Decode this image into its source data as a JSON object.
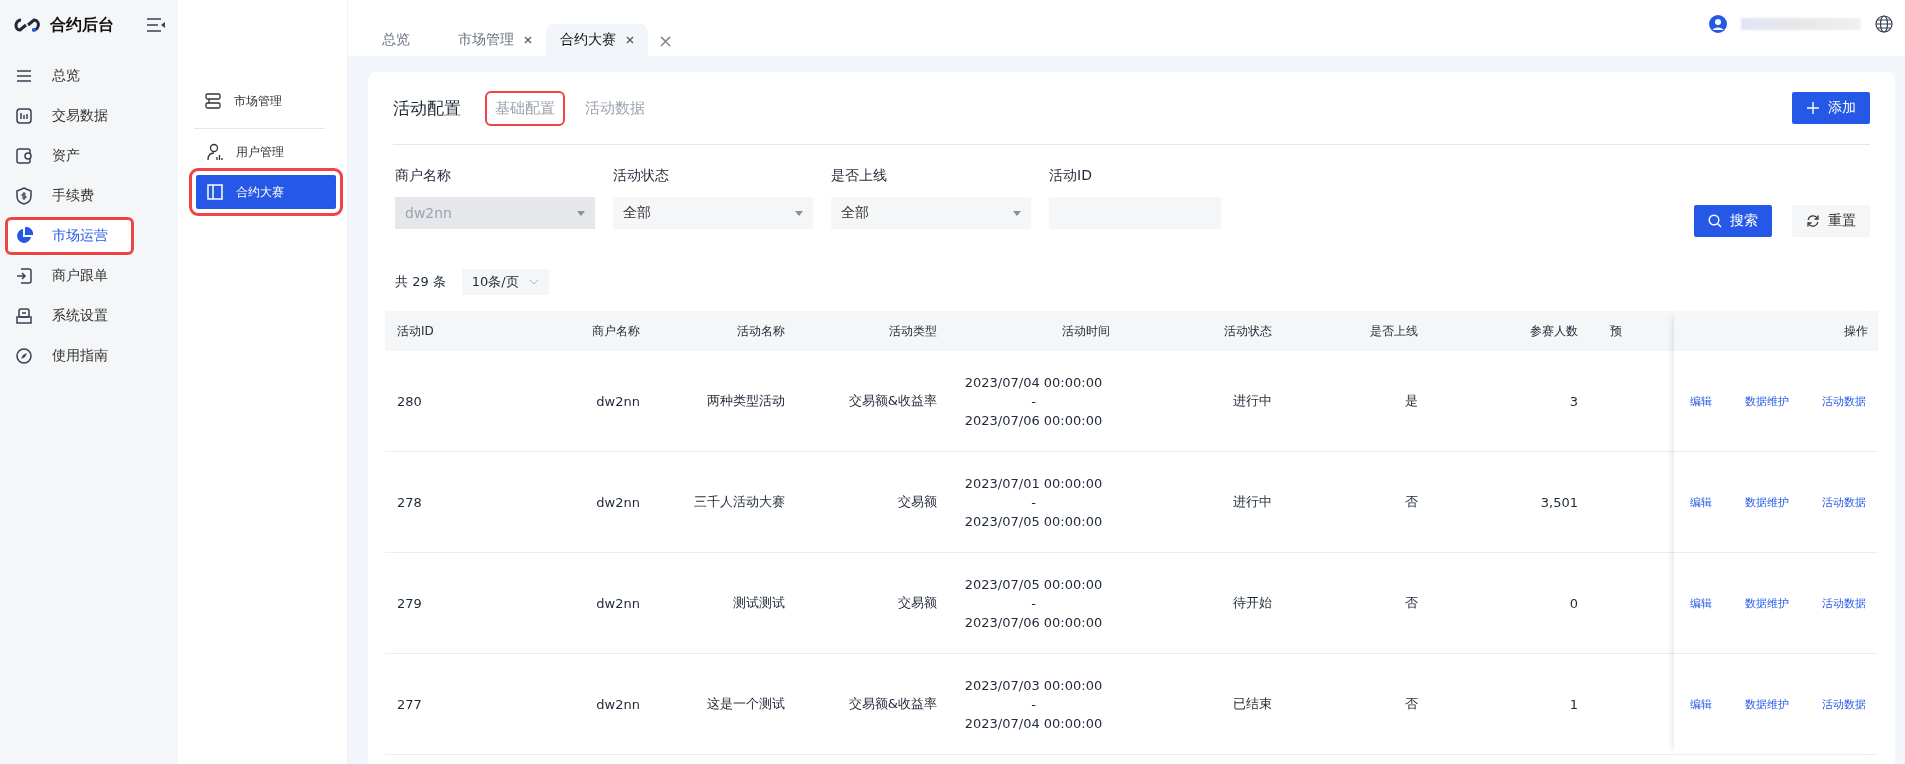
{
  "brand": {
    "title": "合约后台"
  },
  "sidebar": {
    "items": [
      {
        "label": "总览",
        "selected": false,
        "highlighted": false
      },
      {
        "label": "交易数据",
        "selected": false,
        "highlighted": false
      },
      {
        "label": "资产",
        "selected": false,
        "highlighted": false
      },
      {
        "label": "手续费",
        "selected": false,
        "highlighted": false
      },
      {
        "label": "市场运营",
        "selected": true,
        "highlighted": true
      },
      {
        "label": "商户跟单",
        "selected": false,
        "highlighted": false
      },
      {
        "label": "系统设置",
        "selected": false,
        "highlighted": false
      },
      {
        "label": "使用指南",
        "selected": false,
        "highlighted": false
      }
    ]
  },
  "submenu": {
    "items": [
      {
        "label": "市场管理",
        "selected": false,
        "highlighted": false
      },
      {
        "label": "用户管理",
        "selected": false,
        "highlighted": false
      },
      {
        "label": "合约大赛",
        "selected": true,
        "highlighted": true
      }
    ]
  },
  "tabs": [
    {
      "label": "总览",
      "closable": false,
      "selected": false
    },
    {
      "label": "市场管理",
      "closable": true,
      "selected": false
    },
    {
      "label": "合约大赛",
      "closable": true,
      "selected": true
    }
  ],
  "tabs_close_all": "×",
  "page": {
    "title": "活动配置",
    "subtabs": [
      {
        "label": "基础配置",
        "highlighted": true
      },
      {
        "label": "活动数据",
        "highlighted": false
      }
    ],
    "add_button": "添加"
  },
  "filters": [
    {
      "label": "商户名称",
      "kind": "select",
      "value": "dw2nn",
      "disabled": true
    },
    {
      "label": "活动状态",
      "kind": "select",
      "value": "全部",
      "disabled": false
    },
    {
      "label": "是否上线",
      "kind": "select",
      "value": "全部",
      "disabled": false
    },
    {
      "label": "活动ID",
      "kind": "input",
      "disabled": false
    }
  ],
  "search_button": "搜索",
  "reset_button": "重置",
  "total": "共 29 条",
  "page_size": "10条/页",
  "table": {
    "columns": [
      "活动ID",
      "商户名称",
      "活动名称",
      "活动类型",
      "活动时间",
      "活动状态",
      "是否上线",
      "参赛人数",
      "预"
    ],
    "actions_column": "操作",
    "rows": [
      {
        "id": "280",
        "merchant": "dw2nn",
        "name": "两种类型活动",
        "type": "交易额&收益率",
        "start": "2023/07/04 00:00:00",
        "sep": "-",
        "end": "2023/07/06 00:00:00",
        "status": "进行中",
        "online": "是",
        "participants": "3",
        "actions": [
          "编辑",
          "数据维护",
          "活动数据"
        ]
      },
      {
        "id": "278",
        "merchant": "dw2nn",
        "name": "三千人活动大赛",
        "type": "交易额",
        "start": "2023/07/01 00:00:00",
        "sep": "-",
        "end": "2023/07/05 00:00:00",
        "status": "进行中",
        "online": "否",
        "participants": "3,501",
        "actions": [
          "编辑",
          "数据维护",
          "活动数据"
        ]
      },
      {
        "id": "279",
        "merchant": "dw2nn",
        "name": "测试测试",
        "type": "交易额",
        "start": "2023/07/05 00:00:00",
        "sep": "-",
        "end": "2023/07/06 00:00:00",
        "status": "待开始",
        "online": "否",
        "participants": "0",
        "actions": [
          "编辑",
          "数据维护",
          "活动数据"
        ]
      },
      {
        "id": "277",
        "merchant": "dw2nn",
        "name": "这是一个测试",
        "type": "交易额&收益率",
        "start": "2023/07/03 00:00:00",
        "sep": "-",
        "end": "2023/07/04 00:00:00",
        "status": "已结束",
        "online": "否",
        "participants": "1",
        "actions": [
          "编辑",
          "数据维护",
          "活动数据"
        ]
      }
    ]
  }
}
